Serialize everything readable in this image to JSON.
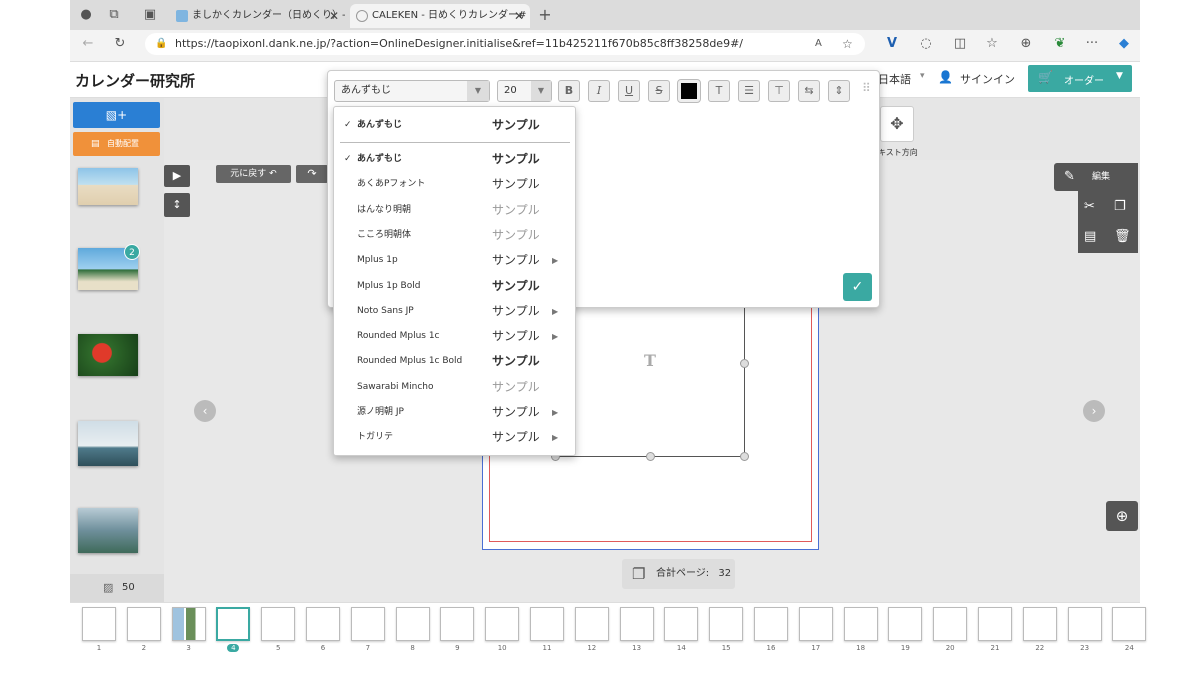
{
  "browser": {
    "tabs": [
      {
        "label": "ましかくカレンダー（日めくり）-"
      },
      {
        "label": "CALEKEN - 日めくりカレンダー#"
      }
    ],
    "url": "https://taopixonl.dank.ne.jp/?action=OnlineDesigner.initialise&ref=11b425211f670b85c8ff38258de9#/"
  },
  "header": {
    "logo": "カレンダー研究所",
    "language": "日本語",
    "signin": "サインイン",
    "order": "オーダー"
  },
  "sidebar": {
    "add_photo": "",
    "auto_place": "自動配置",
    "photo_count": "50",
    "badge": "2"
  },
  "canvas": {
    "undo": "元に戻す",
    "placeholder_glyph": "T",
    "total_pages_label": "合計ページ:",
    "total_pages": "32"
  },
  "right_tools": {
    "text_direction": "キスト方向",
    "edit": "編集"
  },
  "text_toolbar": {
    "font_selected": "あんずもじ",
    "size": "20",
    "bold": "B",
    "italic": "I",
    "underline": "U",
    "strike": "S"
  },
  "font_menu": {
    "current": {
      "name": "あんずもじ",
      "sample": "サンプル"
    },
    "items": [
      {
        "name": "あんずもじ",
        "sample": "サンプル",
        "checked": true,
        "submenu": false
      },
      {
        "name": "あくあPフォント",
        "sample": "サンプル",
        "checked": false,
        "submenu": false
      },
      {
        "name": "はんなり明朝",
        "sample": "サンプル",
        "checked": false,
        "submenu": false
      },
      {
        "name": "こころ明朝体",
        "sample": "サンプル",
        "checked": false,
        "submenu": false
      },
      {
        "name": "Mplus 1p",
        "sample": "サンプル",
        "checked": false,
        "submenu": true
      },
      {
        "name": "Mplus 1p Bold",
        "sample": "サンプル",
        "checked": false,
        "submenu": false
      },
      {
        "name": "Noto Sans JP",
        "sample": "サンプル",
        "checked": false,
        "submenu": true
      },
      {
        "name": "Rounded Mplus 1c",
        "sample": "サンプル",
        "checked": false,
        "submenu": true
      },
      {
        "name": "Rounded Mplus 1c Bold",
        "sample": "サンプル",
        "checked": false,
        "submenu": false
      },
      {
        "name": "Sawarabi Mincho",
        "sample": "サンプル",
        "checked": false,
        "submenu": false
      },
      {
        "name": "源ノ明朝 JP",
        "sample": "サンプル",
        "checked": false,
        "submenu": true
      },
      {
        "name": "トガリテ",
        "sample": "サンプル",
        "checked": false,
        "submenu": true
      }
    ]
  },
  "page_strip": {
    "numbers": [
      "1",
      "2",
      "3",
      "4",
      "5",
      "6",
      "7",
      "8",
      "9",
      "10",
      "11",
      "12",
      "13",
      "14",
      "15",
      "16",
      "17",
      "18",
      "19",
      "20",
      "21",
      "22",
      "23",
      "24"
    ],
    "active": "4"
  },
  "colors": {
    "accent": "#3aa9a2",
    "orange": "#f0913a",
    "blue": "#2a7fd4"
  }
}
